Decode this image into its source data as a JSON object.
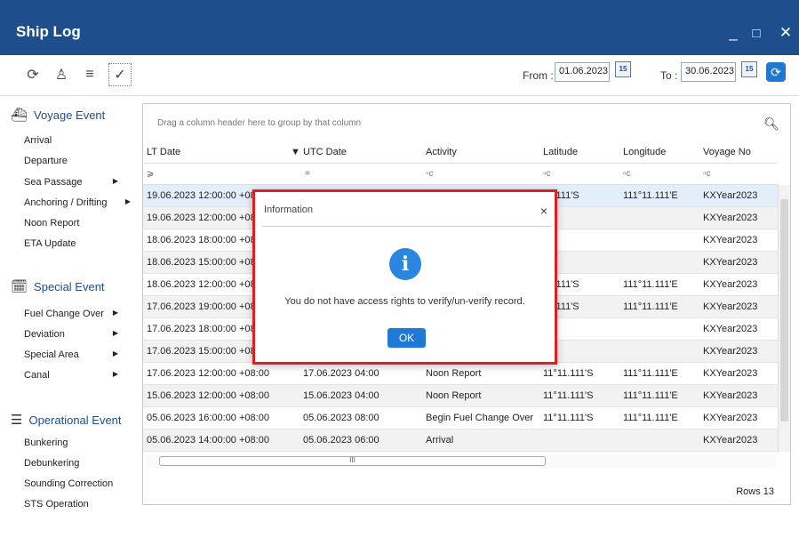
{
  "window": {
    "title": "Ship Log",
    "minimize": "_",
    "maximize": "□",
    "close": "✕"
  },
  "toolbar": {
    "icons": [
      "refresh-icon",
      "person-icon",
      "list-icon",
      "check-icon"
    ],
    "from_label": "From :",
    "from_value": "01.06.2023",
    "to_label": "To :",
    "to_value": "30.06.2023",
    "calendar_day": "15"
  },
  "sidebar": {
    "voyage_event": {
      "title": "Voyage Event",
      "items": [
        {
          "label": "Arrival",
          "arrow": ""
        },
        {
          "label": "Departure",
          "arrow": ""
        },
        {
          "label": "Sea Passage",
          "arrow": "▶"
        },
        {
          "label": "Anchoring / Drifting",
          "arrow": "▶"
        },
        {
          "label": "Noon Report",
          "arrow": ""
        },
        {
          "label": "ETA Update",
          "arrow": ""
        }
      ]
    },
    "special_event": {
      "title": "Special Event",
      "items": [
        {
          "label": "Fuel Change Over",
          "arrow": "▶"
        },
        {
          "label": "Deviation",
          "arrow": "▶"
        },
        {
          "label": "Special Area",
          "arrow": "▶"
        },
        {
          "label": "Canal",
          "arrow": "▶"
        }
      ]
    },
    "operational_event": {
      "title": "Operational Event",
      "items": [
        {
          "label": "Bunkering"
        },
        {
          "label": "Debunkering"
        },
        {
          "label": "Sounding Correction"
        },
        {
          "label": "STS Operation"
        }
      ]
    }
  },
  "grid": {
    "group_hint": "Drag a column header here to group by that column",
    "columns": [
      "LT Date",
      "UTC Date",
      "Activity",
      "Latitude",
      "Longitude",
      "Voyage No"
    ],
    "filters": [
      "⩾",
      "=",
      "▫c",
      "▫c",
      "▫c",
      "▫c"
    ],
    "rows": [
      [
        "19.06.2023 12:00:00 +08:",
        "",
        "",
        "11.111'S",
        "111°11.111'E",
        "KXYear2023"
      ],
      [
        "19.06.2023 12:00:00 +08:",
        "",
        "",
        "",
        "",
        "KXYear2023"
      ],
      [
        "18.06.2023 18:00:00 +08:",
        "",
        "",
        "",
        "",
        "KXYear2023"
      ],
      [
        "18.06.2023 15:00:00 +08:",
        "",
        "",
        "",
        "",
        "KXYear2023"
      ],
      [
        "18.06.2023 12:00:00 +08:",
        "",
        "",
        "11.111'S",
        "111°11.111'E",
        "KXYear2023"
      ],
      [
        "17.06.2023 19:00:00 +08:",
        "",
        "",
        "11.111'S",
        "111°11.111'E",
        "KXYear2023"
      ],
      [
        "17.06.2023 18:00:00 +08:",
        "",
        "",
        "",
        "",
        "KXYear2023"
      ],
      [
        "17.06.2023 15:00:00 +08:",
        "",
        "",
        "",
        "",
        "KXYear2023"
      ],
      [
        "17.06.2023 12:00:00 +08:00",
        "17.06.2023 04:00",
        "Noon Report",
        "11°11.111'S",
        "111°11.111'E",
        "KXYear2023"
      ],
      [
        "15.06.2023 12:00:00 +08:00",
        "15.06.2023 04:00",
        "Noon Report",
        "11°11.111'S",
        "111°11.111'E",
        "KXYear2023"
      ],
      [
        "05.06.2023 16:00:00 +08:00",
        "05.06.2023 08:00",
        "Begin Fuel Change Over",
        "11°11.111'S",
        "111°11.111'E",
        "KXYear2023"
      ],
      [
        "05.06.2023 14:00:00 +08:00",
        "05.06.2023 06:00",
        "Arrival",
        "",
        "",
        "KXYear2023"
      ]
    ],
    "scroll_label": "III",
    "rows_count": "Rows 13"
  },
  "dialog": {
    "title": "Information",
    "close": "×",
    "icon_glyph": "i",
    "message": "You do not have access rights to verify/un-verify record.",
    "ok_label": "OK"
  },
  "colors": {
    "titlebar": "#1f4e8c",
    "accent": "#1e7ad6",
    "highlight_border": "#e02020"
  }
}
